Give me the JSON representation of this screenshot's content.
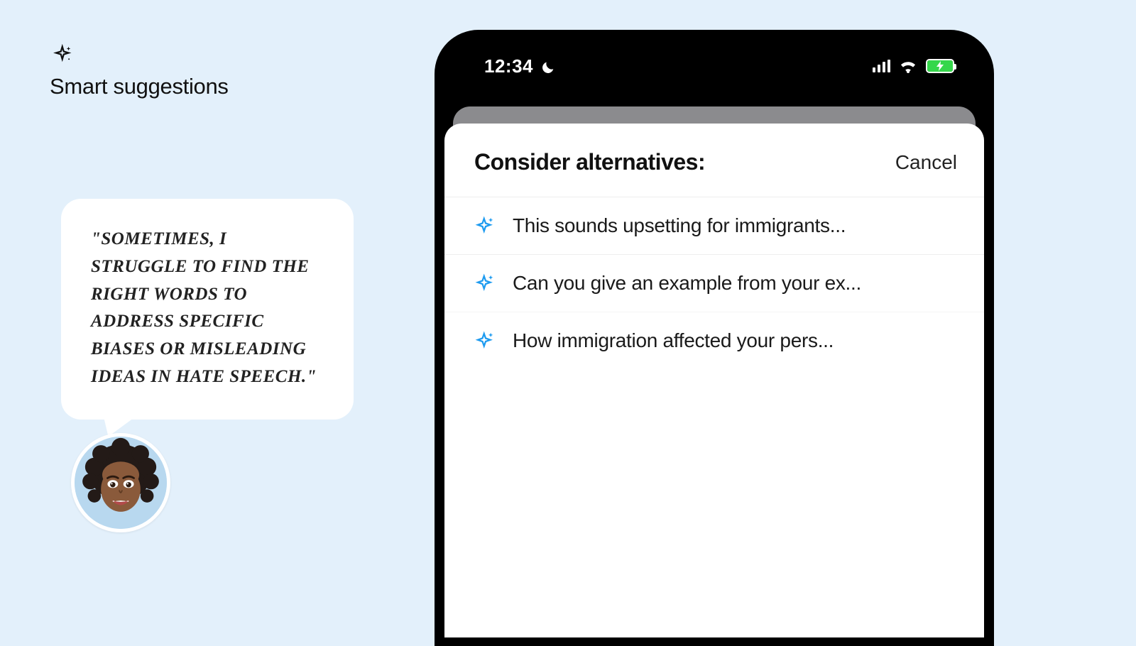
{
  "left": {
    "title": "Smart suggestions",
    "quote": "\"Sometimes, I struggle to find the right words to address specific biases or misleading ideas in hate speech.\""
  },
  "status": {
    "time": "12:34"
  },
  "sheet": {
    "title": "Consider alternatives:",
    "cancel": "Cancel",
    "suggestions": [
      "This sounds upsetting for immigrants...",
      "Can you give an example from your ex...",
      "How immigration affected your pers..."
    ]
  },
  "colors": {
    "accent_blue": "#1d9bf0",
    "battery_green": "#35d74b",
    "page_bg": "#e3f0fb"
  }
}
